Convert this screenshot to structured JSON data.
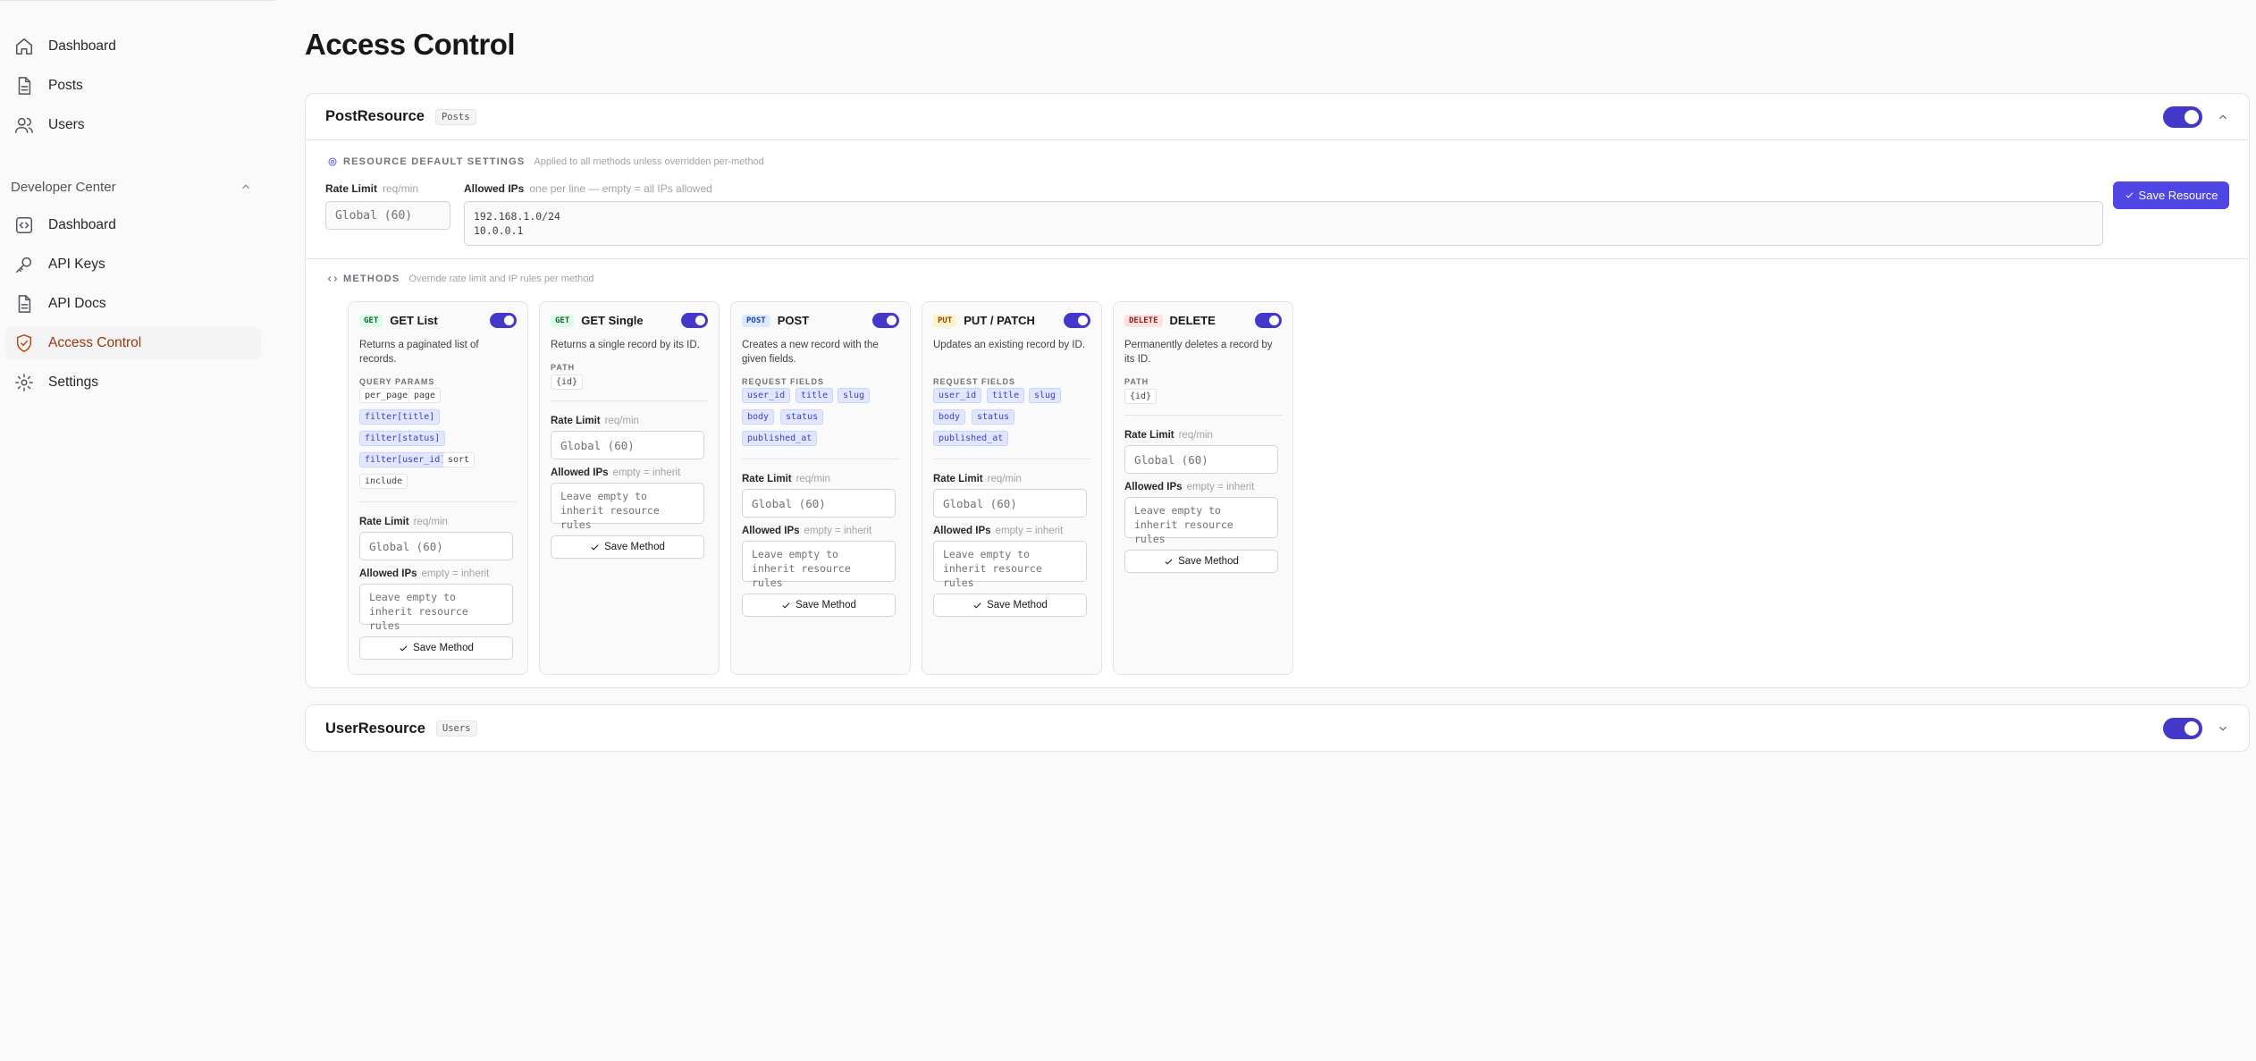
{
  "sidebar": {
    "items": [
      {
        "label": "Dashboard",
        "icon": "home-icon"
      },
      {
        "label": "Posts",
        "icon": "document-icon"
      },
      {
        "label": "Users",
        "icon": "users-icon"
      }
    ],
    "developer_center": {
      "title": "Developer Center",
      "items": [
        {
          "label": "Dashboard",
          "icon": "code-icon"
        },
        {
          "label": "API Keys",
          "icon": "key-icon"
        },
        {
          "label": "API Docs",
          "icon": "document-icon"
        },
        {
          "label": "Access Control",
          "icon": "shield-check-icon",
          "active": true
        },
        {
          "label": "Settings",
          "icon": "gear-icon"
        }
      ]
    }
  },
  "page": {
    "title": "Access Control"
  },
  "resources": [
    {
      "name": "PostResource",
      "tag": "Posts",
      "enabled": true,
      "expanded": true,
      "defaults": {
        "title": "RESOURCE DEFAULT SETTINGS",
        "hint": "Applied to all methods unless overridden per-method",
        "rate_limit_label": "Rate Limit",
        "rate_limit_unit": "req/min",
        "rate_limit_placeholder": "Global (60)",
        "allowed_ips_label": "Allowed IPs",
        "allowed_ips_hint": "one per line — empty = all IPs allowed",
        "allowed_ips_lines": [
          "192.168.1.0/24",
          "10.0.0.1"
        ],
        "save_label": "Save Resource"
      },
      "methods_title": "METHODS",
      "methods_hint": "Override rate limit and IP rules per method",
      "methods": [
        {
          "verb": "GET",
          "name": "GET List",
          "enabled": true,
          "desc": "Returns a paginated list of records.",
          "section": "QUERY PARAMS",
          "params": [
            "per_page",
            "page",
            "filter[title]",
            "filter[status]",
            "filter[user_id]",
            "sort",
            "include"
          ],
          "rate_limit_label": "Rate Limit",
          "rate_limit_unit": "req/min",
          "rate_limit_placeholder": "Global (60)",
          "ips_label": "Allowed IPs",
          "ips_hint": "empty = inherit",
          "ips_placeholder": "Leave empty to inherit resource rules",
          "save_label": "Save Method"
        },
        {
          "verb": "GET",
          "name": "GET Single",
          "enabled": true,
          "desc": "Returns a single record by its ID.",
          "section": "PATH",
          "params": [
            "{id}"
          ],
          "rate_limit_label": "Rate Limit",
          "rate_limit_unit": "req/min",
          "rate_limit_placeholder": "Global (60)",
          "ips_label": "Allowed IPs",
          "ips_hint": "empty = inherit",
          "ips_placeholder": "Leave empty to inherit resource rules",
          "save_label": "Save Method"
        },
        {
          "verb": "POST",
          "name": "POST",
          "enabled": true,
          "desc": "Creates a new record with the given fields.",
          "section": "REQUEST FIELDS",
          "params": [
            "user_id",
            "title",
            "slug",
            "body",
            "status",
            "published_at"
          ],
          "rate_limit_label": "Rate Limit",
          "rate_limit_unit": "req/min",
          "rate_limit_placeholder": "Global (60)",
          "ips_label": "Allowed IPs",
          "ips_hint": "empty = inherit",
          "ips_placeholder": "Leave empty to inherit resource rules",
          "save_label": "Save Method"
        },
        {
          "verb": "PUT",
          "name": "PUT / PATCH",
          "enabled": true,
          "desc": "Updates an existing record by ID.",
          "section": "REQUEST FIELDS",
          "params": [
            "user_id",
            "title",
            "slug",
            "body",
            "status",
            "published_at"
          ],
          "rate_limit_label": "Rate Limit",
          "rate_limit_unit": "req/min",
          "rate_limit_placeholder": "Global (60)",
          "ips_label": "Allowed IPs",
          "ips_hint": "empty = inherit",
          "ips_placeholder": "Leave empty to inherit resource rules",
          "save_label": "Save Method"
        },
        {
          "verb": "DELETE",
          "name": "DELETE",
          "enabled": true,
          "desc": "Permanently deletes a record by its ID.",
          "section": "PATH",
          "params": [
            "{id}"
          ],
          "rate_limit_label": "Rate Limit",
          "rate_limit_unit": "req/min",
          "rate_limit_placeholder": "Global (60)",
          "ips_label": "Allowed IPs",
          "ips_hint": "empty = inherit",
          "ips_placeholder": "Leave empty to inherit resource rules",
          "save_label": "Save Method"
        }
      ]
    },
    {
      "name": "UserResource",
      "tag": "Users",
      "enabled": true,
      "expanded": false
    }
  ],
  "colors": {
    "accent": "#4f46e5",
    "toggle_on": "#4338ca",
    "active_nav": "#c2410c"
  }
}
